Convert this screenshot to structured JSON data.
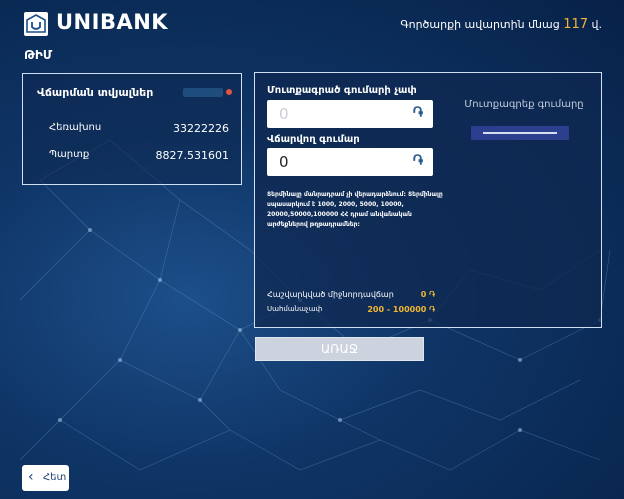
{
  "header": {
    "brand": "UNIBANK",
    "session_prefix": "Գործարքի ավարտին մնաց",
    "session_count": "117",
    "session_unit": "վ."
  },
  "page": {
    "title": "ԹԻՄ"
  },
  "payment_details": {
    "title": "Վճարման տվյալներ",
    "rows": [
      {
        "label": "Հեռախոս",
        "value": "33222226"
      },
      {
        "label": "Պարտք",
        "value": "8827.531601"
      }
    ]
  },
  "form": {
    "inserted_label": "Մուտքագրած գումարի չափ",
    "inserted_value": "0",
    "payable_label": "Վճարվող գումար",
    "payable_value": "0",
    "currency_symbol": "֏",
    "insert_title": "Մուտքագրեք գումարը",
    "note": "Տերմինալը մանրադրամ չի վերադարձնում: Տերմինալը սպասարկում է 1000, 2000, 5000, 10000, 20000,50000,100000 ՀՀ դրամ անվանական արժեքներով թղթադրամներ:",
    "commission_label": "Հաշվարկված միջնորդավճար",
    "commission_value": "0 ֏",
    "limit_label": "Սահմանաչափ",
    "limit_value": "200 - 100000 ֏"
  },
  "buttons": {
    "next": "ԱՌԱՋ",
    "back": "Հետ"
  },
  "colors": {
    "accent": "#f2b632",
    "panel_border": "#cfe0f5",
    "insert_bar": "#2b3f8e"
  }
}
